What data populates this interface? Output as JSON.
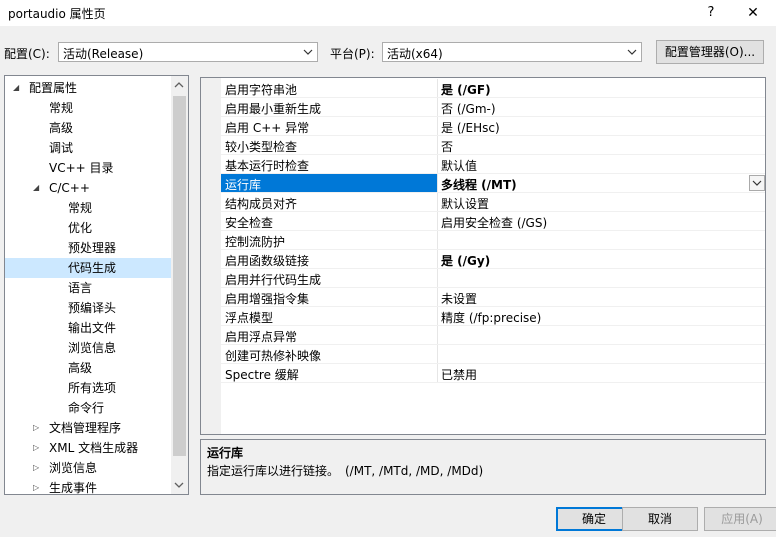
{
  "window": {
    "title": "portaudio 属性页",
    "help": "?",
    "close": "✕"
  },
  "config_row": {
    "config_label": "配置(C):",
    "config_value": "活动(Release)",
    "platform_label": "平台(P):",
    "platform_value": "活动(x64)",
    "config_manager": "配置管理器(O)..."
  },
  "tree": {
    "items": [
      {
        "label": "配置属性",
        "level": 0,
        "expander": "expanded"
      },
      {
        "label": "常规",
        "level": 1
      },
      {
        "label": "高级",
        "level": 1
      },
      {
        "label": "调试",
        "level": 1
      },
      {
        "label": "VC++ 目录",
        "level": 1
      },
      {
        "label": "C/C++",
        "level": 1,
        "expander": "expanded"
      },
      {
        "label": "常规",
        "level": 2
      },
      {
        "label": "优化",
        "level": 2
      },
      {
        "label": "预处理器",
        "level": 2
      },
      {
        "label": "代码生成",
        "level": 2,
        "selected": true
      },
      {
        "label": "语言",
        "level": 2
      },
      {
        "label": "预编译头",
        "level": 2
      },
      {
        "label": "输出文件",
        "level": 2
      },
      {
        "label": "浏览信息",
        "level": 2
      },
      {
        "label": "高级",
        "level": 2
      },
      {
        "label": "所有选项",
        "level": 2
      },
      {
        "label": "命令行",
        "level": 2
      },
      {
        "label": "文档管理程序",
        "level": 1,
        "expander": "collapsed"
      },
      {
        "label": "XML 文档生成器",
        "level": 1,
        "expander": "collapsed"
      },
      {
        "label": "浏览信息",
        "level": 1,
        "expander": "collapsed"
      },
      {
        "label": "生成事件",
        "level": 1,
        "expander": "collapsed"
      }
    ]
  },
  "properties": [
    {
      "name": "启用字符串池",
      "value": "是 (/GF)",
      "bold": true
    },
    {
      "name": "启用最小重新生成",
      "value": "否 (/Gm-)"
    },
    {
      "name": "启用 C++ 异常",
      "value": "是 (/EHsc)"
    },
    {
      "name": "较小类型检查",
      "value": "否"
    },
    {
      "name": "基本运行时检查",
      "value": "默认值"
    },
    {
      "name": "运行库",
      "value": "多线程 (/MT)",
      "bold": true,
      "selected": true
    },
    {
      "name": "结构成员对齐",
      "value": "默认设置"
    },
    {
      "name": "安全检查",
      "value": "启用安全检查 (/GS)"
    },
    {
      "name": "控制流防护",
      "value": ""
    },
    {
      "name": "启用函数级链接",
      "value": "是 (/Gy)",
      "bold": true
    },
    {
      "name": "启用并行代码生成",
      "value": ""
    },
    {
      "name": "启用增强指令集",
      "value": "未设置"
    },
    {
      "name": "浮点模型",
      "value": "精度 (/fp:precise)"
    },
    {
      "name": "启用浮点异常",
      "value": ""
    },
    {
      "name": "创建可热修补映像",
      "value": ""
    },
    {
      "name": "Spectre 缓解",
      "value": "已禁用"
    }
  ],
  "description": {
    "title": "运行库",
    "text": "指定运行库以进行链接。　(/MT, /MTd, /MD, /MDd)"
  },
  "buttons": {
    "ok": "确定",
    "cancel": "取消",
    "apply": "应用(A)"
  },
  "colors": {
    "selection": "#0078d7",
    "tree_selection": "#cce8ff"
  }
}
